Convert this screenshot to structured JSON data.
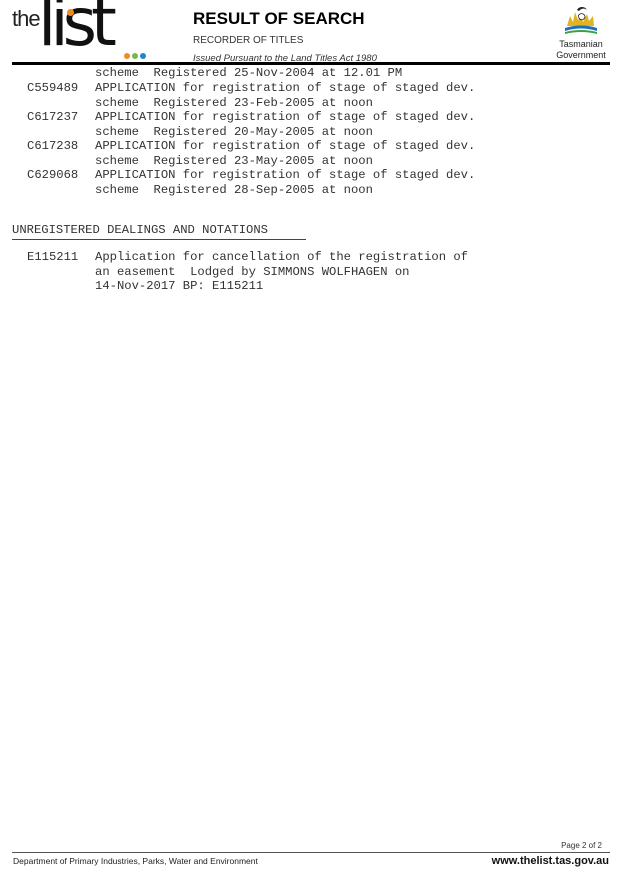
{
  "header": {
    "logo": {
      "the": "the",
      "list": "list",
      "dot_colors": [
        "#f08a24",
        "#7ab648",
        "#1e88c9"
      ],
      "i_dot_color": "#f08a24"
    },
    "title": "RESULT OF SEARCH",
    "subtitle": "RECORDER OF TITLES",
    "issued": "Issued Pursuant to the Land Titles Act 1980",
    "government": {
      "line1": "Tasmanian",
      "line2": "Government",
      "icon": "tasmanian-devil-emblem-icon"
    }
  },
  "dealings": [
    {
      "code": "",
      "lines": [
        "scheme  Registered 25-Nov-2004 at 12.01 PM"
      ]
    },
    {
      "code": "C559489",
      "lines": [
        "APPLICATION for registration of stage of staged dev.",
        "scheme  Registered 23-Feb-2005 at noon"
      ]
    },
    {
      "code": "C617237",
      "lines": [
        "APPLICATION for registration of stage of staged dev.",
        "scheme  Registered 20-May-2005 at noon"
      ]
    },
    {
      "code": "C617238",
      "lines": [
        "APPLICATION for registration of stage of staged dev.",
        "scheme  Registered 23-May-2005 at noon"
      ]
    },
    {
      "code": "C629068",
      "lines": [
        "APPLICATION for registration of stage of staged dev.",
        "scheme  Registered 28-Sep-2005 at noon"
      ]
    }
  ],
  "unregistered": {
    "heading": "UNREGISTERED DEALINGS AND NOTATIONS",
    "items": [
      {
        "code": "E115211",
        "lines": [
          "Application for cancellation of the registration of",
          "an easement  Lodged by SIMMONS WOLFHAGEN on",
          "14-Nov-2017 BP: E115211"
        ]
      }
    ]
  },
  "footer": {
    "page": "Page 2 of 2",
    "department": "Department of Primary Industries, Parks, Water and Environment",
    "url": "www.thelist.tas.gov.au"
  }
}
